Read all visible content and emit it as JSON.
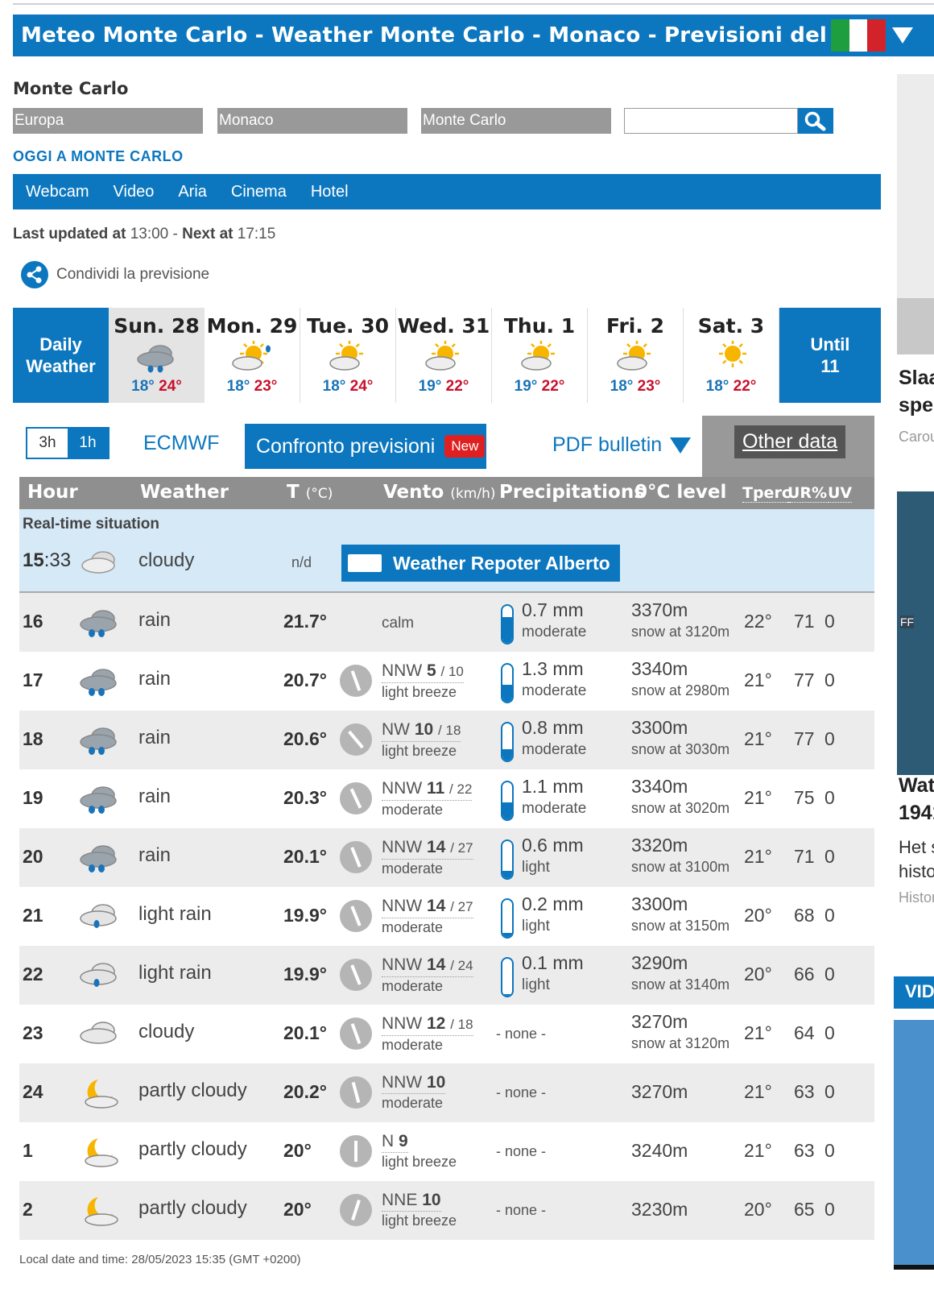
{
  "header": {
    "title": "Meteo Monte Carlo - Weather Monte Carlo - Monaco - Previsioni del tempo or...",
    "flag_colors": [
      "#1e9e3e",
      "#ffffff",
      "#d2232a"
    ]
  },
  "location": {
    "city": "Monte Carlo",
    "selects": [
      "Europa",
      "Monaco",
      "Monte Carlo"
    ],
    "search_value": ""
  },
  "nav": {
    "section": "OGGI A MONTE CARLO",
    "items": [
      "Webcam",
      "Video",
      "Aria",
      "Cinema",
      "Hotel"
    ]
  },
  "update": {
    "last_label": "Last updated at",
    "last_time": "13:00",
    "sep": " - ",
    "next_label": "Next at",
    "next_time": "17:15"
  },
  "share_label": "Condividi la previsione",
  "days_bar": {
    "daily_label_1": "Daily",
    "daily_label_2": "Weather",
    "until_1": "Until",
    "until_2": "11",
    "days": [
      {
        "name": "Sun. 28",
        "icon": "rain-cloud-icon",
        "min": "18°",
        "max": "24°"
      },
      {
        "name": "Mon. 29",
        "icon": "sun-cloud-drop-icon",
        "min": "18°",
        "max": "23°"
      },
      {
        "name": "Tue. 30",
        "icon": "sun-cloud-icon",
        "min": "18°",
        "max": "24°"
      },
      {
        "name": "Wed. 31",
        "icon": "sun-cloud-icon",
        "min": "19°",
        "max": "22°"
      },
      {
        "name": "Thu. 1",
        "icon": "sun-cloud-icon",
        "min": "19°",
        "max": "22°"
      },
      {
        "name": "Fri. 2",
        "icon": "sun-cloud-icon",
        "min": "18°",
        "max": "23°"
      },
      {
        "name": "Sat. 3",
        "icon": "sun-icon",
        "min": "18°",
        "max": "22°"
      }
    ]
  },
  "toolbar": {
    "tab_3h": "3h",
    "tab_1h": "1h",
    "model": "ECMWF",
    "confronto": "Confronto previsioni",
    "new_badge": "New",
    "pdf": "PDF bulletin",
    "other": "Other data"
  },
  "table_header": {
    "hour": "Hour",
    "weather": "Weather",
    "temp": "T",
    "temp_unit": "(°C)",
    "wind": "Vento",
    "wind_unit": "(km/h)",
    "prec": "Precipitations",
    "level": "0°C level",
    "tperc": "Tperc",
    "ur": "UR%",
    "uv": "UV"
  },
  "realtime": {
    "label": "Real-time situation",
    "hour": "15",
    "minutes": ":33",
    "weather": "cloudy",
    "temp": "n/d",
    "reporter": "Weather Repoter Alberto"
  },
  "rows": [
    {
      "hour": "16",
      "icon": "rain",
      "weather": "rain",
      "temp": "21.7°",
      "wind_calm": "calm",
      "prec": "0.7 mm",
      "prec_desc": "moderate",
      "fill": 0.7,
      "level": "3370m",
      "snow": "snow at 3120m",
      "tperc": "22°",
      "ur": "71",
      "uv": "0"
    },
    {
      "hour": "17",
      "icon": "rain",
      "weather": "rain",
      "temp": "20.7°",
      "dir": "NNW",
      "speed": "5",
      "gust": "10",
      "wind_desc": "light breeze",
      "angle": -20,
      "prec": "1.3 mm",
      "prec_desc": "moderate",
      "fill": 0.45,
      "level": "3340m",
      "snow": "snow at 2980m",
      "tperc": "21°",
      "ur": "77",
      "uv": "0"
    },
    {
      "hour": "18",
      "icon": "rain",
      "weather": "rain",
      "temp": "20.6°",
      "dir": "NW",
      "speed": "10",
      "gust": "18",
      "wind_desc": "light breeze",
      "angle": -40,
      "prec": "0.8 mm",
      "prec_desc": "moderate",
      "fill": 0.3,
      "level": "3300m",
      "snow": "snow at 3030m",
      "tperc": "21°",
      "ur": "77",
      "uv": "0"
    },
    {
      "hour": "19",
      "icon": "rain",
      "weather": "rain",
      "temp": "20.3°",
      "dir": "NNW",
      "speed": "11",
      "gust": "22",
      "wind_desc": "moderate",
      "angle": -25,
      "prec": "1.1 mm",
      "prec_desc": "moderate",
      "fill": 0.45,
      "level": "3340m",
      "snow": "snow at 3020m",
      "tperc": "21°",
      "ur": "75",
      "uv": "0"
    },
    {
      "hour": "20",
      "icon": "rain",
      "weather": "rain",
      "temp": "20.1°",
      "dir": "NNW",
      "speed": "14",
      "gust": "27",
      "wind_desc": "moderate",
      "angle": -22,
      "prec": "0.6 mm",
      "prec_desc": "light",
      "fill": 0.2,
      "level": "3320m",
      "snow": "snow at 3100m",
      "tperc": "21°",
      "ur": "71",
      "uv": "0"
    },
    {
      "hour": "21",
      "icon": "light-rain",
      "weather": "light rain",
      "temp": "19.9°",
      "dir": "NNW",
      "speed": "14",
      "gust": "27",
      "wind_desc": "moderate",
      "angle": -22,
      "prec": "0.2 mm",
      "prec_desc": "light",
      "fill": 0.1,
      "level": "3300m",
      "snow": "snow at 3150m",
      "tperc": "20°",
      "ur": "68",
      "uv": "0"
    },
    {
      "hour": "22",
      "icon": "light-rain",
      "weather": "light rain",
      "temp": "19.9°",
      "dir": "NNW",
      "speed": "14",
      "gust": "24",
      "wind_desc": "moderate",
      "angle": -22,
      "prec": "0.1 mm",
      "prec_desc": "light",
      "fill": 0.04,
      "level": "3290m",
      "snow": "snow at 3140m",
      "tperc": "20°",
      "ur": "66",
      "uv": "0"
    },
    {
      "hour": "23",
      "icon": "cloudy",
      "weather": "cloudy",
      "temp": "20.1°",
      "dir": "NNW",
      "speed": "12",
      "gust": "18",
      "wind_desc": "moderate",
      "angle": -20,
      "prec_none": "- none -",
      "level": "3270m",
      "snow": "snow at 3120m",
      "tperc": "21°",
      "ur": "64",
      "uv": "0"
    },
    {
      "hour": "24",
      "icon": "moon",
      "weather": "partly cloudy",
      "temp": "20.2°",
      "dir": "NNW",
      "speed": "10",
      "wind_desc": "moderate",
      "angle": -15,
      "prec_none": "- none -",
      "level": "3270m",
      "tperc": "21°",
      "ur": "63",
      "uv": "0"
    },
    {
      "hour": "1",
      "icon": "moon",
      "weather": "partly cloudy",
      "temp": "20°",
      "dir": "N",
      "speed": "9",
      "wind_desc": "light breeze",
      "angle": 0,
      "prec_none": "- none -",
      "level": "3240m",
      "tperc": "21°",
      "ur": "63",
      "uv": "0"
    },
    {
      "hour": "2",
      "icon": "moon",
      "weather": "partly cloudy",
      "temp": "20°",
      "dir": "NNE",
      "speed": "10",
      "wind_desc": "light breeze",
      "angle": 18,
      "prec_none": "- none -",
      "level": "3230m",
      "tperc": "20°",
      "ur": "65",
      "uv": "0"
    }
  ],
  "local_time": "Local date and time: 28/05/2023 15:35 (GMT +0200)",
  "sidebar": {
    "head1_a": "Slaa",
    "head1_b": "spel",
    "src1": "Carou",
    "head2_a": "Wat",
    "head2_b": "1941",
    "text2_a": "Het s",
    "text2_b": "histo",
    "src2": "Histor",
    "map_label": "FF",
    "video_label": "VID"
  }
}
